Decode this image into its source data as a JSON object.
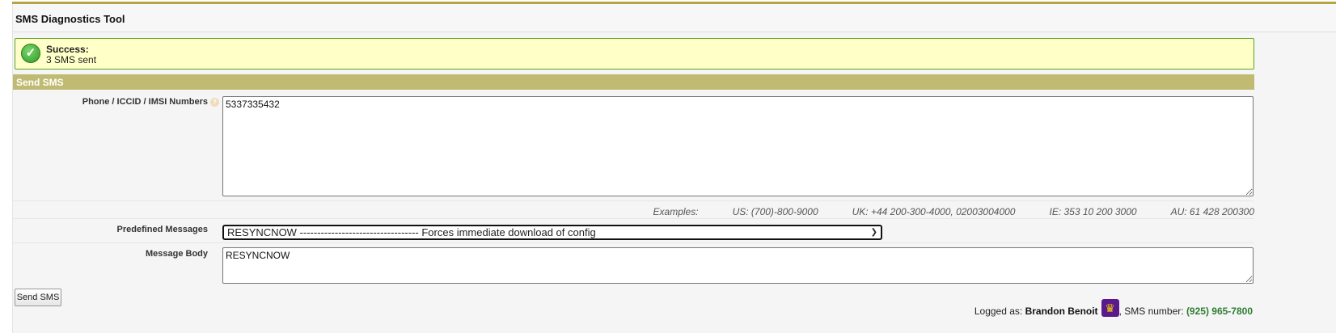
{
  "header": {
    "title": "SMS Diagnostics Tool"
  },
  "alert": {
    "title": "Success:",
    "message": "3 SMS sent",
    "icon": "check-circle-icon"
  },
  "section": {
    "title": "Send SMS"
  },
  "form": {
    "numbers_label": "Phone / ICCID / IMSI Numbers",
    "numbers_value": "5337335432",
    "examples_label": "Examples:",
    "examples": [
      "US: (700)-800-9000",
      "UK: +44 200-300-4000, 02003004000",
      "IE: 353 10 200 3000",
      "AU: 61 428 200300"
    ],
    "predefined_label": "Predefined Messages",
    "predefined_selected": "RESYNCNOW ---------------------------------- Forces immediate download of config",
    "body_label": "Message Body",
    "body_value": "RESYNCNOW",
    "send_label": "Send SMS"
  },
  "footer": {
    "logged_as": "Logged as: ",
    "user": "Brandon Benoit",
    "sms_label": ", SMS number: ",
    "sms_number": "(925) 965-7800"
  },
  "colors": {
    "accent": "#c0bb73",
    "success_bg": "#ffffc8",
    "number": "#2e7d32"
  }
}
